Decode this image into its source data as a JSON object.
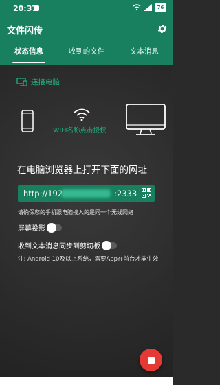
{
  "status_bar": {
    "time": "20:37",
    "battery": "76"
  },
  "app": {
    "title": "文件闪传"
  },
  "tabs": [
    {
      "label": "状态信息",
      "active": true
    },
    {
      "label": "收到的文件",
      "active": false
    },
    {
      "label": "文本消息",
      "active": false
    }
  ],
  "connection": {
    "connect_label": "连接电脑",
    "wifi_label": "WIFI名称点击授权"
  },
  "main": {
    "headline": "在电脑浏览器上打开下面的网址",
    "url_prefix": "http://192.",
    "url_port": ":2333",
    "same_network_note": "请确保您的手机跟电脑接入的是同一个无线网络",
    "screen_projection_label": "屏幕投影",
    "screen_projection_on": false,
    "clipboard_sync_label": "收到文本消息同步到剪切板",
    "clipboard_sync_on": false,
    "android_note": "注: Android 10及以上系统，需要App在前台才能生效"
  },
  "icons": {
    "settings": "gear-icon",
    "connect": "monitor-phone-icon",
    "phone": "phone-icon",
    "wifi": "wifi-icon",
    "monitor": "monitor-icon",
    "qr": "qr-code-icon",
    "stop": "stop-icon"
  },
  "colors": {
    "brand_green": "#18805e",
    "accent_green": "#1fb27f",
    "fab_red": "#e53935",
    "background": "#2a2a2a"
  }
}
